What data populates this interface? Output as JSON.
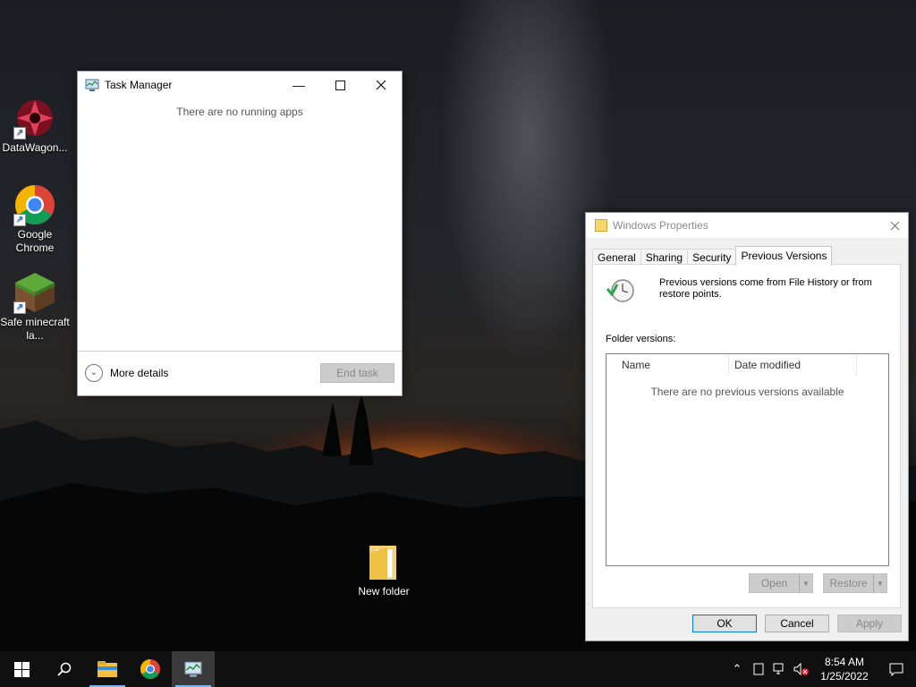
{
  "desktop": {
    "icons": [
      {
        "label": "DataWagon...",
        "icon": "datawagon-icon"
      },
      {
        "label": "Google Chrome",
        "icon": "chrome-icon"
      },
      {
        "label": "Safe minecraft la...",
        "icon": "minecraft-icon"
      },
      {
        "label": "New folder",
        "icon": "folder-icon"
      }
    ]
  },
  "task_manager": {
    "title": "Task Manager",
    "empty_message": "There are no running apps",
    "more_details": "More details",
    "end_task": "End task"
  },
  "properties": {
    "title": "Windows Properties",
    "tabs": [
      "General",
      "Sharing",
      "Security",
      "Previous Versions"
    ],
    "active_tab": "Previous Versions",
    "info_text": "Previous versions come from File History or from restore points.",
    "folder_versions_label": "Folder versions:",
    "columns": [
      "Name",
      "Date modified"
    ],
    "empty_message": "There are no previous versions available",
    "open_label": "Open",
    "restore_label": "Restore",
    "ok_label": "OK",
    "cancel_label": "Cancel",
    "apply_label": "Apply"
  },
  "taskbar": {
    "apps": [
      "windows-start-icon",
      "search-icon",
      "file-explorer-icon",
      "chrome-icon",
      "task-manager-icon"
    ],
    "time": "8:54 AM",
    "date": "1/25/2022"
  },
  "colors": {
    "taskbar": "#101010",
    "accent": "#0078d7",
    "disabled_button": "#cccccc"
  }
}
